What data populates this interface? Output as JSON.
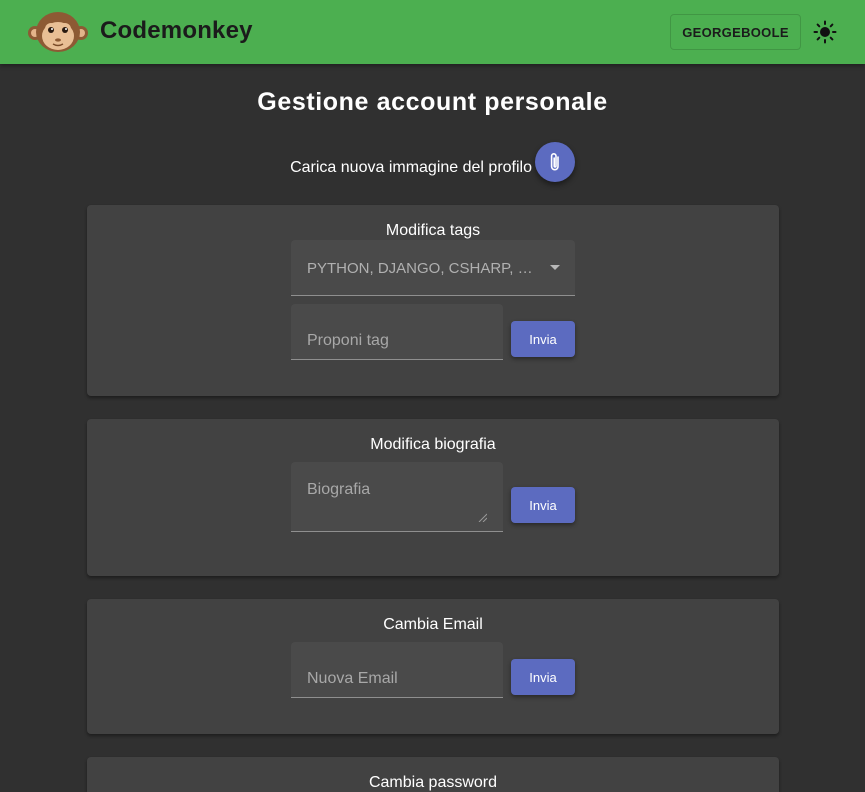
{
  "header": {
    "brand": "Codemonkey",
    "user_button": "GEORGEBOOLE",
    "logo_icon": "monkey-icon",
    "theme_icon": "sun-icon"
  },
  "page": {
    "title": "Gestione account personale",
    "upload_label": "Carica nuova immagine del profilo",
    "upload_icon": "paperclip-icon"
  },
  "tags_section": {
    "title": "Modifica tags",
    "selected_tags": "PYTHON, DJANGO, CSHARP, P...",
    "propose_placeholder": "Proponi tag",
    "submit_label": "Invia"
  },
  "bio_section": {
    "title": "Modifica biografia",
    "bio_placeholder": "Biografia",
    "submit_label": "Invia"
  },
  "email_section": {
    "title": "Cambia Email",
    "email_placeholder": "Nuova Email",
    "submit_label": "Invia"
  },
  "password_section": {
    "title": "Cambia password"
  },
  "colors": {
    "appbar": "#4caf50",
    "background": "#303030",
    "card": "#424242",
    "accent": "#5c6bc0"
  }
}
